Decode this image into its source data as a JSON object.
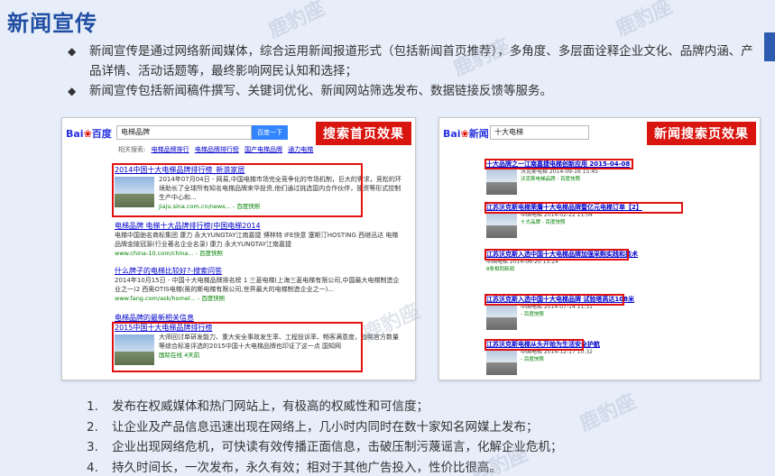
{
  "title": "新闻宣传",
  "bullets": [
    "新闻宣传是通过网络新闻媒体，综合运用新闻报道形式（包括新闻首页推荐），多角度、多层面诠释企业文化、品牌内涵、产品详情、活动话题等，最终影响网民认知和选择；",
    "新闻宣传包括新闻稿件撰写、关键词优化、新闻网站筛选发布、数据链接反馈等服务。"
  ],
  "bullet_mark": "◆",
  "watermark": "鹿豹座",
  "shot_left": {
    "ribbon": "搜索首页效果",
    "logo": {
      "a": "Bai",
      "b": "百度"
    },
    "query": "电梯品牌",
    "search_btn": "百度一下",
    "related_label": "相关搜索:",
    "related": [
      "电梯品牌排行",
      "电梯品牌排行榜",
      "国产电梯品牌",
      "通力电梯"
    ],
    "results": [
      {
        "title": "2014中国十大电梯品牌排行榜_新浪家居",
        "snippet": "2014年07月04日 - 网易,中国电梯市场完全竞争化的市场机制，巨大的需求，竞松的环境助长了全球所有知名电梯品牌来华投资,他们通过挑选国内合作伙伴，独资等形式控制生产中心和...",
        "url": "jiaju.sina.com.cn/news... - 百度快照"
      },
      {
        "title": "电梯品牌 电梯十大品牌排行榜|中国电梯2014",
        "snippet": "电梯中国驰名商标集团 康力 永大YUNGTAY江南嘉捷 博林特 IFE快意 塞斯汀HOSTING 西继迅达 电梯品牌金陵冠源(行业著名企业名录) 康力 永大YUNGTAY江南嘉捷",
        "url": "www.china-10.com/china... - 百度快照"
      },
      {
        "title": "什么牌子的电梯比较好?-搜索问答",
        "snippet": "2014年10月15日 - 中国十大电梯品牌排名榜 1 三菱电梯(上海三菱电梯有限公司,中国最大电梯制造企业之一)2 西奥OTIS电梯(奥的斯电梯有限公司,世界最大的电梯制造企业之一)...",
        "url": "www.fang.com/ask/homel... - 百度快照"
      },
      {
        "title": "电梯品牌的最新相关信息",
        "sub": "2015中国十大电梯品牌排行榜",
        "snippet": "大师回讨单研发能力、重大安全事故发生率、工程投诉率、畅客满意度，战略官方数量等综合标准评选的2015中国十大电梯品牌也印证了这一点 国知网",
        "url": "国际在线 4天前"
      }
    ]
  },
  "shot_right": {
    "ribbon": "新闻搜索页效果",
    "logo": {
      "a": "Bai",
      "b": "新闻"
    },
    "query": "十大电梯",
    "results": [
      {
        "title": "十大品牌之一江南嘉捷电梯创新应用 2015-04-08",
        "snippet": "沃克斯电梯 2014-09-16 15:45",
        "url": "沃克斯电梯品牌 - 百度快照"
      },
      {
        "title": "江苏沃克斯电梯荣膺十大电梯品牌暨亿元电梯订单【2】",
        "snippet": "中国电梯 2014-02-22 11:04",
        "url": "十大品牌 - 百度快照"
      },
      {
        "title": "江苏沃克斯入选中国十大电梯品牌加强采购实践和技术",
        "snippet": "中国电梯 2014-06-20 15:24",
        "url": "8条相同新闻"
      },
      {
        "title": "江苏沃克斯入选中国十大电梯品牌 试验塔高达108米",
        "snippet": "中国电梯 2014-07-14 11:31",
        "url": "- 百度快照"
      },
      {
        "title": "江苏沃克斯电梯从头开始为生活安全护航",
        "snippet": "中国电梯 2014-12-17 10:32",
        "url": "- 百度快照"
      }
    ]
  },
  "numbered": [
    {
      "n": "1.",
      "text": "发布在权威媒体和热门网站上，有极高的权威性和可信度；"
    },
    {
      "n": "2.",
      "text": "让企业及产品信息迅速出现在网络上，几小时内同时在数十家知名网媒上发布；"
    },
    {
      "n": "3.",
      "text": "企业出现网络危机，可快读有效传播正面信息，击破压制污蔑谣言，化解企业危机；"
    },
    {
      "n": "4.",
      "text": "持久时间长，一次发布，永久有效；相对于其他广告投入，性价比很高。"
    }
  ]
}
